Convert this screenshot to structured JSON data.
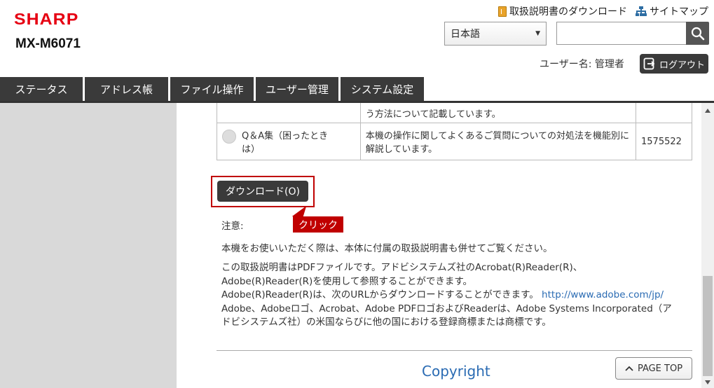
{
  "header": {
    "brand": "SHARP",
    "model": "MX-M6071",
    "links": {
      "manual_download": "取扱説明書のダウンロード",
      "sitemap": "サイトマップ"
    },
    "language_selected": "日本語",
    "search_placeholder": "",
    "username": "ユーザー名: 管理者",
    "logout_label": "ログアウト"
  },
  "nav": {
    "tabs": [
      {
        "label": "ステータス"
      },
      {
        "label": "アドレス帳"
      },
      {
        "label": "ファイル操作"
      },
      {
        "label": "ユーザー管理"
      },
      {
        "label": "システム設定"
      }
    ]
  },
  "table": {
    "row1_desc": "う方法について記載しています。",
    "row2_name_line1": "Q＆A集（困ったとき",
    "row2_name_line2": "は）",
    "row2_desc_line1": "本機の操作に関してよくあるご質問についての対処法を機能別に",
    "row2_desc_line2": "解説しています。",
    "row2_size": "1575522"
  },
  "download_button": "ダウンロード(O)",
  "callout": "クリック",
  "notes": {
    "title": "注意:",
    "line1": "本機をお使いいただく際は、本体に付属の取扱説明書も併せてご覧ください。",
    "line2": "この取扱説明書はPDFファイルです。アドビシステムズ社のAcrobat(R)Reader(R)、",
    "line3": "Adobe(R)Reader(R)を使用して参照することができます。",
    "line4": "Adobe(R)Reader(R)は、次のURLからダウンロードすることができます。",
    "link": "http://www.adobe.com/jp/",
    "line5": "Adobe、Adobeロゴ、Acrobat、Adobe PDFロゴおよびReaderは、Adobe Systems Incorporated（ア",
    "line6": "ドビシステムズ社）の米国ならびに他の国における登録商標または商標です。"
  },
  "footer": {
    "copyright": "Copyright",
    "page_top": "PAGE TOP"
  },
  "colors": {
    "brand_red": "#e60012",
    "dark_button": "#3a3a3a",
    "highlight_red": "#c00000",
    "link_blue": "#2a6bb3"
  }
}
